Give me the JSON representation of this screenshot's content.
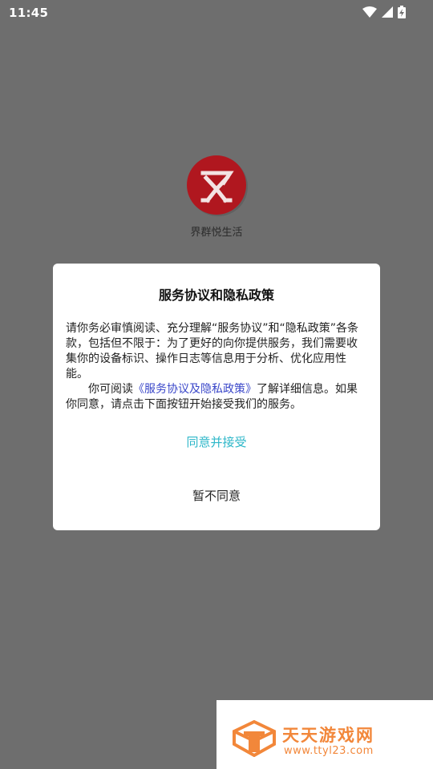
{
  "status_bar": {
    "time": "11:45",
    "icons": [
      "wifi-icon",
      "cellular-signal-icon",
      "battery-charging-icon"
    ]
  },
  "app": {
    "name": "界群悦生活",
    "logo_icon": "app-logo-icon",
    "logo_color": "#b0171f"
  },
  "dialog": {
    "title": "服务协议和隐私政策",
    "body_para1": "请你务必审慎阅读、充分理解“服务协议”和“隐私政策”各条款，包括但不限于：为了更好的向你提供服务，我们需要收集你的设备标识、操作日志等信息用于分析、优化应用性能。",
    "body_para2_prefix": "你可阅读",
    "body_link": "《服务协议及隐私政策》",
    "body_para2_suffix": "了解详细信息。如果你同意，请点击下面按钮开始接受我们的服务。",
    "accept_label": "同意并接受",
    "decline_label": "暂不同意",
    "accept_color": "#2eb7c9",
    "link_color": "#3a47c9"
  },
  "watermark": {
    "title": "天天游戏网",
    "url": "www.ttyl23.com",
    "color": "#f2873a"
  }
}
